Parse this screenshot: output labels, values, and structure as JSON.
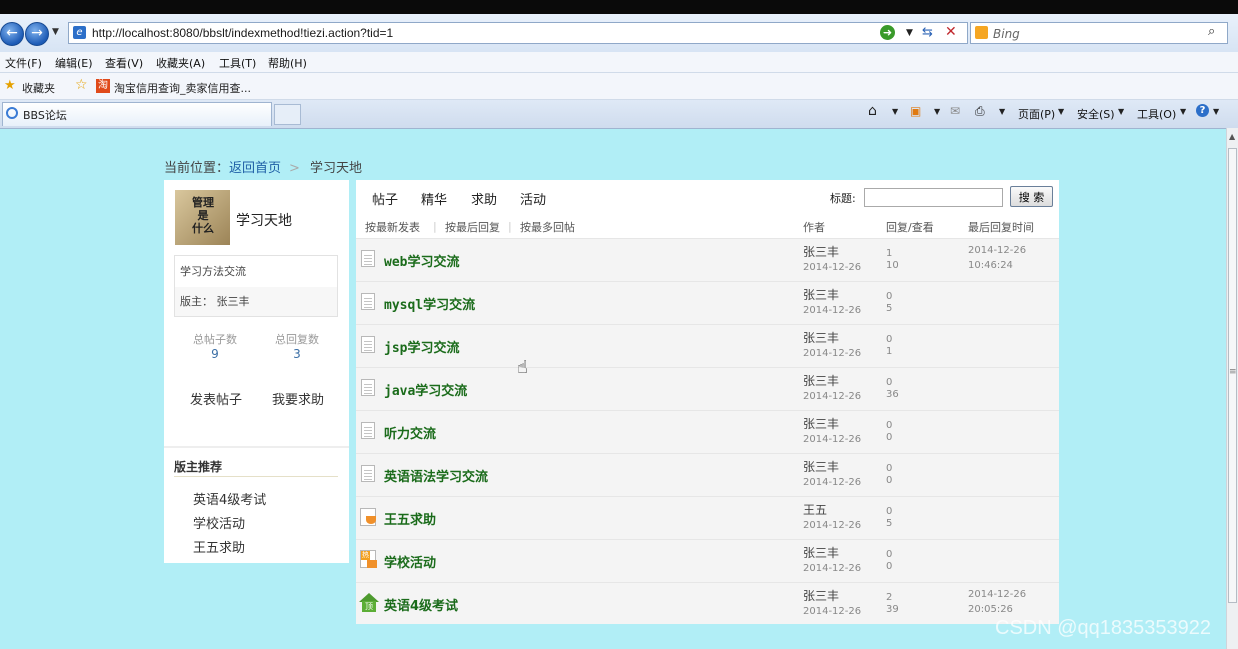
{
  "browser": {
    "address": "http://localhost:8080/bbslt/indexmethod!tiezi.action?tid=1",
    "search_placeholder": "Bing",
    "menu": [
      "文件(F)",
      "编辑(E)",
      "查看(V)",
      "收藏夹(A)",
      "工具(T)",
      "帮助(H)"
    ],
    "favorites_label": "收藏夹",
    "favorite_link": "淘宝信用查询_卖家信用查...",
    "tab_title": "BBS论坛",
    "tools": [
      "页面(P)",
      "安全(S)",
      "工具(O)"
    ]
  },
  "breadcrumb": {
    "prefix": "当前位置：",
    "home": "返回首页",
    "separator": ">",
    "current": "学习天地"
  },
  "board": {
    "name": "学习天地",
    "logo_lines": [
      "管理",
      "是",
      "什么"
    ],
    "description": "学习方法交流",
    "moderator_label": "版主：",
    "moderator": "张三丰",
    "stats": [
      {
        "label": "总帖子数",
        "value": "9"
      },
      {
        "label": "总回复数",
        "value": "3"
      }
    ],
    "actions": [
      "发表帖子",
      "我要求助"
    ],
    "recommend_title": "版主推荐",
    "recommend": [
      "英语4级考试",
      "学校活动",
      "王五求助"
    ]
  },
  "tabs": [
    "帖子",
    "精华",
    "求助",
    "活动"
  ],
  "search": {
    "label": "标题:",
    "button": "搜 索"
  },
  "sorts": [
    "按最新发表",
    "按最后回复",
    "按最多回帖"
  ],
  "columns": {
    "author": "作者",
    "reply_view": "回复/查看",
    "last_reply": "最后回复时间"
  },
  "posts": [
    {
      "title": "web学习交流",
      "icon": "doc",
      "author": "张三丰",
      "date": "2014-12-26",
      "replies": "1",
      "views": "10",
      "last_date": "2014-12-26",
      "last_time": "10:46:24"
    },
    {
      "title": "mysql学习交流",
      "icon": "doc",
      "author": "张三丰",
      "date": "2014-12-26",
      "replies": "0",
      "views": "5",
      "last_date": "",
      "last_time": ""
    },
    {
      "title": "jsp学习交流",
      "icon": "doc",
      "author": "张三丰",
      "date": "2014-12-26",
      "replies": "0",
      "views": "1",
      "last_date": "",
      "last_time": ""
    },
    {
      "title": "java学习交流",
      "icon": "doc",
      "author": "张三丰",
      "date": "2014-12-26",
      "replies": "0",
      "views": "36",
      "last_date": "",
      "last_time": ""
    },
    {
      "title": "听力交流",
      "icon": "doc",
      "author": "张三丰",
      "date": "2014-12-26",
      "replies": "0",
      "views": "0",
      "last_date": "",
      "last_time": ""
    },
    {
      "title": "英语语法学习交流",
      "icon": "doc",
      "author": "张三丰",
      "date": "2014-12-26",
      "replies": "0",
      "views": "0",
      "last_date": "",
      "last_time": ""
    },
    {
      "title": "王五求助",
      "icon": "help",
      "author": "王五",
      "date": "2014-12-26",
      "replies": "0",
      "views": "5",
      "last_date": "",
      "last_time": ""
    },
    {
      "title": "学校活动",
      "icon": "hot",
      "author": "张三丰",
      "date": "2014-12-26",
      "replies": "0",
      "views": "0",
      "last_date": "",
      "last_time": ""
    },
    {
      "title": "英语4级考试",
      "icon": "top",
      "author": "张三丰",
      "date": "2014-12-26",
      "replies": "2",
      "views": "39",
      "last_date": "2014-12-26",
      "last_time": "20:05:26"
    }
  ],
  "watermark": "CSDN @qq1835353922"
}
